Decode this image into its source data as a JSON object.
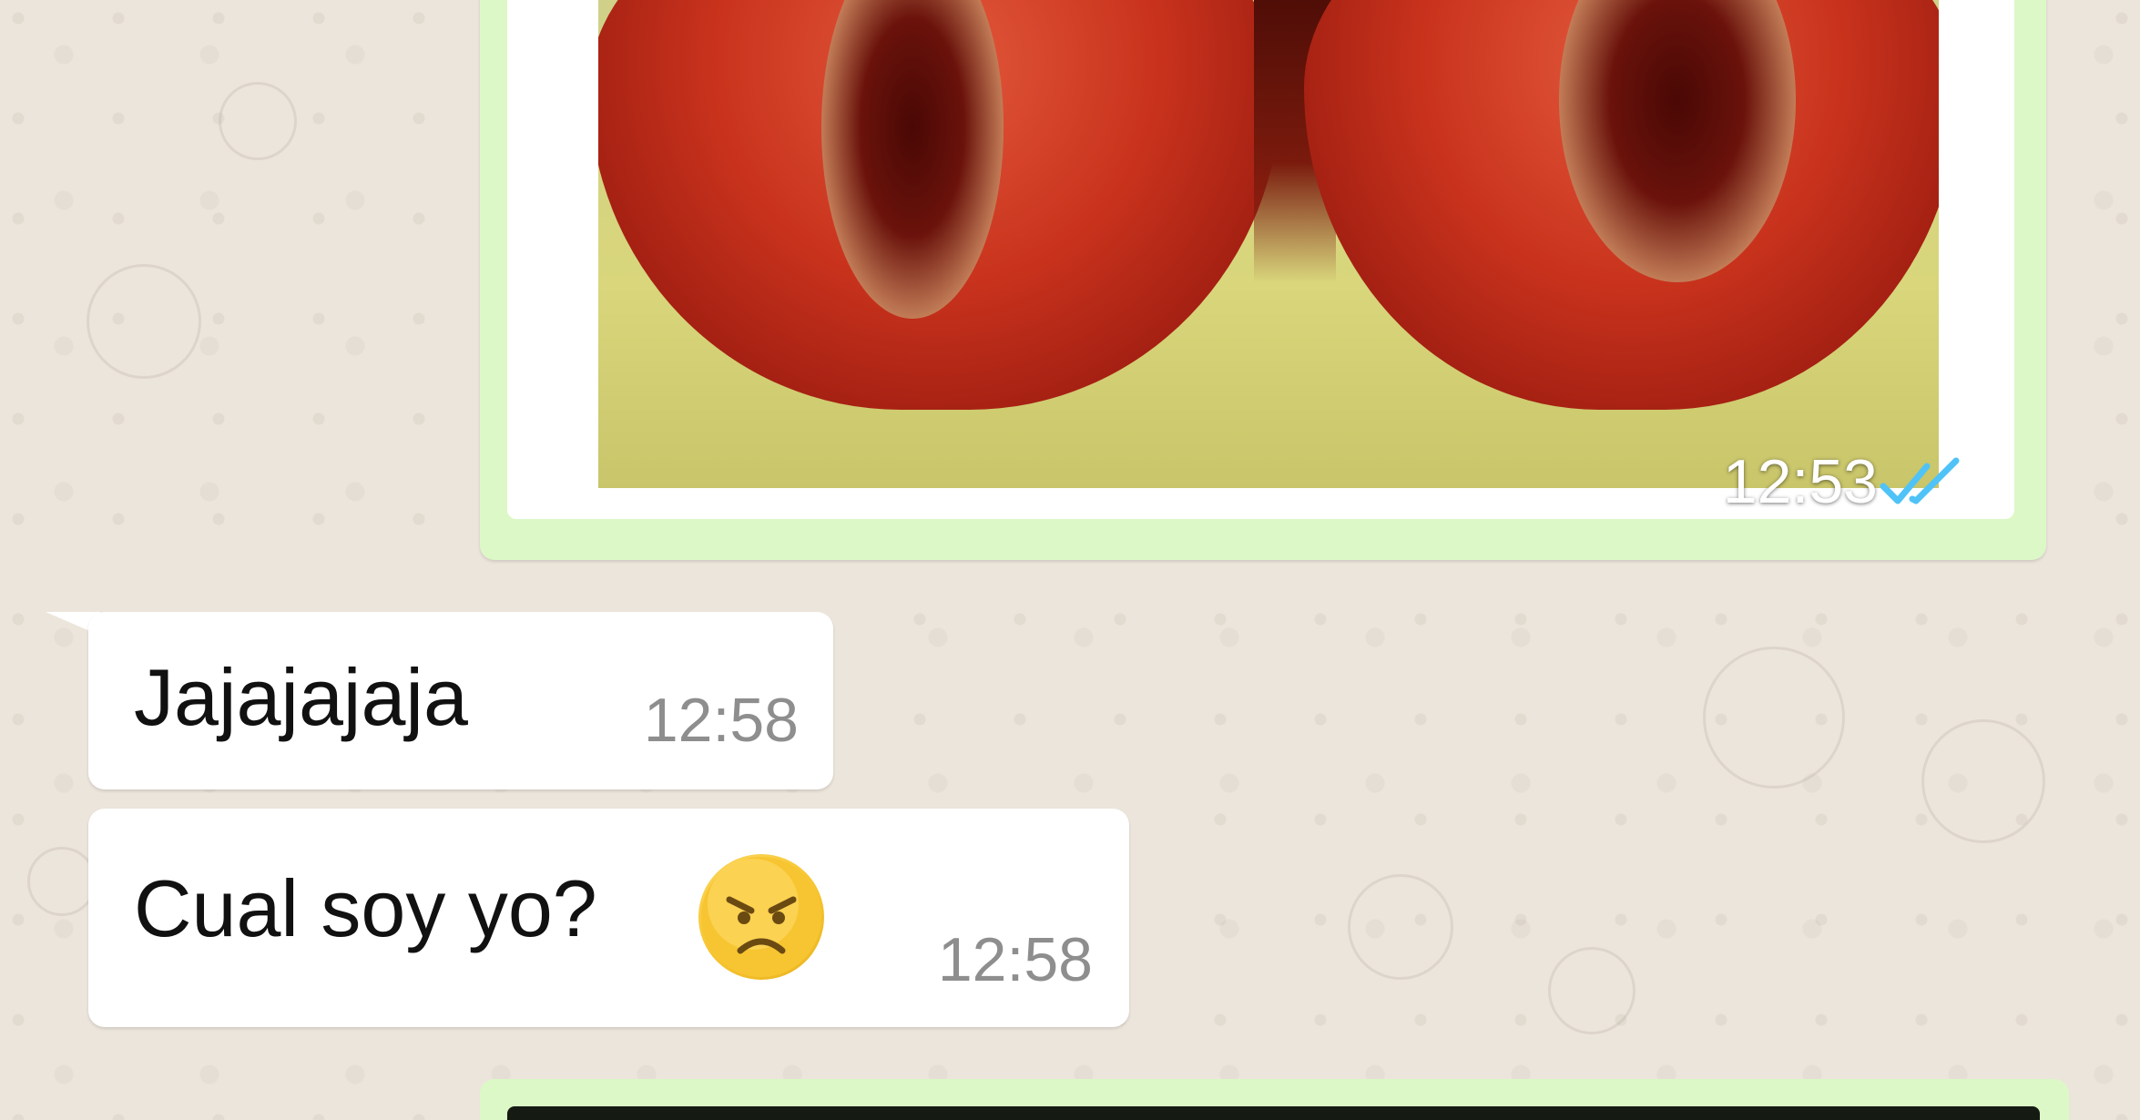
{
  "chat": {
    "messages": [
      {
        "direction": "outgoing",
        "type": "image",
        "time": "12:53",
        "status": "read"
      },
      {
        "direction": "incoming",
        "type": "text",
        "text": "Jajajajaja",
        "time": "12:58"
      },
      {
        "direction": "incoming",
        "type": "text",
        "text": "Cual soy yo?",
        "emoji": "angry-face",
        "time": "12:58"
      },
      {
        "direction": "outgoing",
        "type": "image"
      }
    ]
  },
  "colors": {
    "wallpaper": "#ece5dc",
    "outgoing_bubble": "#dcf8c6",
    "incoming_bubble": "#ffffff",
    "read_ticks": "#4fc3f7",
    "timestamp": "#8e8e8e"
  },
  "icons": {
    "read_status": "double-check-icon",
    "emoji": "angry-face-emoji"
  }
}
